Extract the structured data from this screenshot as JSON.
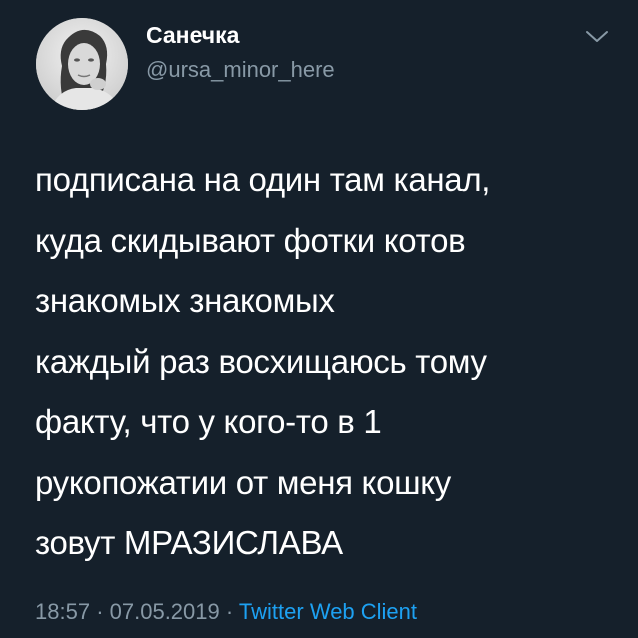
{
  "user": {
    "display_name": "Санечка",
    "handle": "@ursa_minor_here"
  },
  "tweet": {
    "lines": [
      "подписана на один там канал,",
      "куда скидывают фотки котов",
      "знакомых знакомых",
      "каждый раз восхищаюсь тому",
      "факту, что у кого-то в 1",
      "рукопожатии от меня кошку",
      "зовут МРАЗИСЛАВА"
    ]
  },
  "meta": {
    "time": "18:57",
    "separator": "·",
    "date": "07.05.2019",
    "source": "Twitter Web Client"
  },
  "icons": {
    "caret": "chevron-down-icon"
  },
  "colors": {
    "background": "#15202b",
    "text": "#ffffff",
    "secondary": "#8899a6",
    "link": "#1da1f2"
  }
}
